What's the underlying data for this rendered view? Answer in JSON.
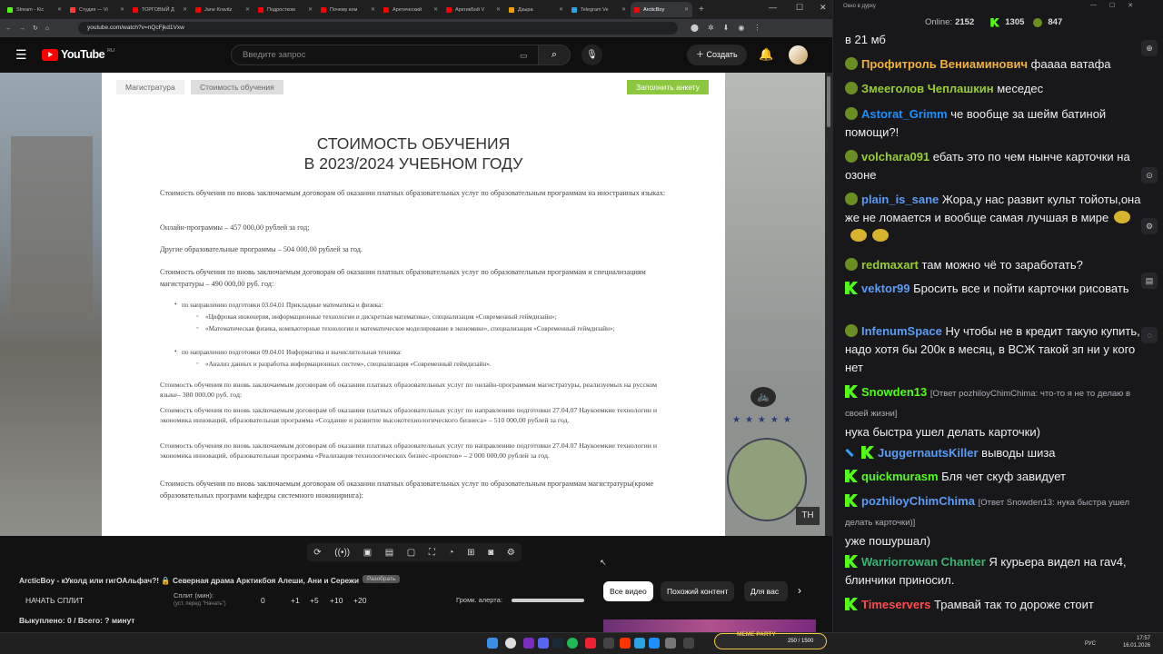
{
  "browser": {
    "tabs": [
      {
        "label": "Stream - Kic",
        "color": "#53fc18"
      },
      {
        "label": "Студия — Vi",
        "color": "#ff3b3b"
      },
      {
        "label": "ТОРГОВЫЙ Д",
        "color": "#ff0000"
      },
      {
        "label": "Jane Kravitz",
        "color": "#ff0000"
      },
      {
        "label": "Подростком",
        "color": "#ff0000"
      },
      {
        "label": "Почему ком",
        "color": "#ff0000"
      },
      {
        "label": "Арктический",
        "color": "#ff0000"
      },
      {
        "label": "АрктикБой V",
        "color": "#ff0000"
      },
      {
        "label": "Дзыра",
        "color": "#f0a000"
      },
      {
        "label": "Telegram Ve",
        "color": "#2aa3e0"
      },
      {
        "label": "ArcticBoy",
        "color": "#ff0000"
      }
    ],
    "url": "youtube.com/watch?v=nQcFjkd1Vxw"
  },
  "youtube": {
    "logo_text": "YouTube",
    "region": "RU",
    "search_placeholder": "Введите запрос",
    "create_label": "Создать"
  },
  "document": {
    "tab1": "Магистратура",
    "tab2": "Стоимость обучения",
    "cta": "Заполнить анкету",
    "title1": "СТОИМОСТЬ ОБУЧЕНИЯ",
    "title2": "В 2023/2024  УЧЕБНОМ ГОДУ",
    "p1": "Стоимость обучения по вновь заключаемым договорам об оказании платных образовательных услуг по образовательным программам на иностранных языках:",
    "p2": "Онлайн-программы – 457 000,00 рублей за год;",
    "p3": "Другие образовательные программы – 504 000,00 рублей за год.",
    "p4": "Стоимость обучения по вновь заключаемым договорам об оказании платных образовательных услуг по образовательным программам и специализациям магистратуры – 490 000,00 руб. год:",
    "li1": "по направлению подготовки 03.04.01 Прикладные математика и физика:",
    "li1a": "«Цифровая инженерия, информационные технологии и дискретная математика», специализация «Современный геймдизайн»;",
    "li1b": "«Математическая физика, компьютерные технологии и математическое моделирование в экономике», специализация «Современный геймдизайн»;",
    "li2": "по направлению подготовки 09.04.01 Информатика и вычислительная техника:",
    "li2a": "«Анализ данных и разработка информационных систем», специализация «Современный геймдизайн».",
    "p5": "Стоимость обучения по вновь заключаемым договорам об оказании платных образовательных услуг по онлайн-программам магистратуры, реализуемых на русском языке– 380 000,00 руб. год:",
    "p6": "Стоимость обучения по вновь заключаемым договорам об оказании платных образовательных услуг по направлению подготовки 27.04.07 Наукоемкие технологии и экономика инноваций, образовательная программа «Создание и развитие высокотехнологического бизнеса» – 510 000,00 рублей за год.",
    "p7": "Стоимость обучения по вновь заключаемым договорам об оказании платных образовательных услуг по направлению подготовки 27.04.07 Наукоемкие технологии и экономика инноваций, образовательная программа «Реализация технологических бизнес-проектов» – 2 000 000,00 рублей за год.",
    "p8": "Стоимость обучения по вновь заключаемым договорам об оказании платных образовательных услуг по образовательным программам магистратуры(кроме образовательных программ кафедры системного инжиниринга):"
  },
  "player": {
    "video_title": "ArcticBoy - кУколд или гигОАльфач?! 🔒 Северная драма Арктикбоя Алеши, Ани и Сережи",
    "tag": "Разобрать",
    "split_button": "НАЧАТЬ СПЛИТ",
    "split_label": "Сплит (мин):",
    "split_hint": "(уст. перед \"Начать\")",
    "split_value": "0",
    "increments": [
      "+1",
      "+5",
      "+10",
      "+20"
    ],
    "alert_label": "Громк. алерта:",
    "bought": "Выкуплено: 0 / Всего: ? минут",
    "chips": [
      "Все видео",
      "Похожий контент",
      "Для вас"
    ]
  },
  "chat": {
    "window_title": "Окно в дурку",
    "online_label": "Online:",
    "online": "2152",
    "kick_count": "1305",
    "other_count": "847",
    "messages": [
      {
        "user": "",
        "color": "#efeff1",
        "text": "в 21 мб",
        "badge": ""
      },
      {
        "user": "Профитроль Вениаминович",
        "color": "#f2b13b",
        "text": "фаааа ватафа",
        "badge": "pepe"
      },
      {
        "user": "Змееголов Чеплашкин",
        "color": "#9acd32",
        "text": "меседес",
        "badge": "pepe"
      },
      {
        "user": "Astorat_Grimm",
        "color": "#1e90ff",
        "text": "че вообще за шейм батиной помощи?!",
        "badge": "pepe"
      },
      {
        "user": "volchara091",
        "color": "#9acd32",
        "text": "ебать это по чем нынче карточки на озоне",
        "badge": "pepe"
      },
      {
        "user": "plain_is_sane",
        "color": "#5b9cf5",
        "text": "Жора,у нас развит культ тойоты,она же не ломается и вообще самая лучшая в мире",
        "badge": "pepe"
      },
      {
        "user": "redmaxart",
        "color": "#9acd32",
        "text": "там можно чё то заработать?",
        "badge": "pepe"
      },
      {
        "user": "vektor99",
        "color": "#5b9cf5",
        "text": "Бросить все и пойти карточки рисовать",
        "badge": "k"
      },
      {
        "user": "InfenumSpace",
        "color": "#5b9cf5",
        "text": "Ну чтобы не в кредит такую купить, надо хотя бы 200к в месяц, в ВСЖ такой зп ни у кого нет",
        "badge": "pepe"
      },
      {
        "user": "Snowden13",
        "color": "#53fc18",
        "reply": "[Ответ pozhiloyChimChima: что-то я не то делаю в своей жизни]",
        "text": "нука быстра ушел делать карточки)",
        "badge": "k"
      },
      {
        "user": "JuggernautsKiller",
        "color": "#5b9cf5",
        "text": "выводы шиза",
        "badge": "swk"
      },
      {
        "user": "quickmurasm",
        "color": "#53fc18",
        "text": "Бля чет скуф завидует",
        "badge": "k"
      },
      {
        "user": "pozhiloyChimChima",
        "color": "#5b9cf5",
        "reply": "[Ответ Snowden13: нука быстра ушел делать карточки)]",
        "text": "уже пошуршал)",
        "badge": "k"
      },
      {
        "user": "Warriorrowan Chanter",
        "color": "#3cb371",
        "text": "Я курьера видел на rav4, блинчики приносил.",
        "badge": "k"
      },
      {
        "user": "Timeservers",
        "color": "#ff4d4d",
        "text": "Трамвай так то дороже стоит",
        "badge": "k"
      }
    ]
  },
  "taskbar": {
    "lang": "РУС",
    "time": "17:57",
    "date": "16.01.2026",
    "widget": "MEME PARTY",
    "widget_count": "250 / 1500"
  }
}
